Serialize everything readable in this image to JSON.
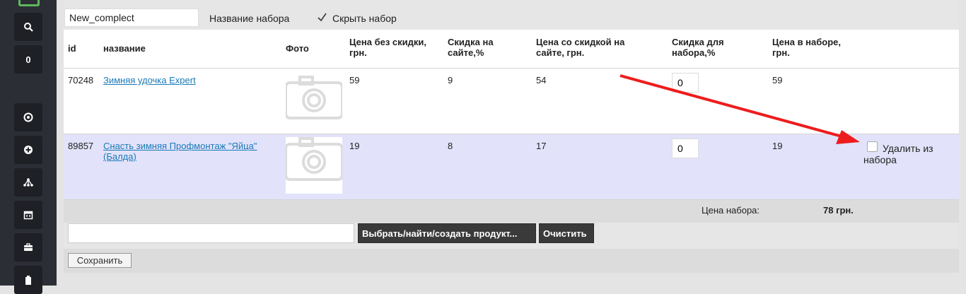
{
  "sidebar": {
    "items": [
      {
        "icon": "search-icon"
      },
      {
        "label": "0"
      },
      {
        "icon": "lifebuoy-icon"
      },
      {
        "icon": "plus-circle-icon"
      },
      {
        "icon": "sitemap-icon"
      },
      {
        "icon": "calendar-icon"
      },
      {
        "icon": "briefcase-icon"
      },
      {
        "icon": "clipboard-icon"
      }
    ]
  },
  "set": {
    "name_value": "New_complect",
    "name_label": "Название набора",
    "hide_checked": true,
    "hide_label": "Скрыть набор"
  },
  "table": {
    "headers": {
      "id": "id",
      "name": "название",
      "photo": "Фото",
      "price": "Цена без скидки, грн.",
      "site_discount": "Скидка на сайте,%",
      "discounted_price": "Цена со скидкой на сайте, грн.",
      "set_discount": "Скидка для набора,%",
      "set_price": "Цена в наборе, грн."
    },
    "rows": [
      {
        "id": "70248",
        "name": "Зимняя удочка Expert",
        "price": "59",
        "site_discount": "9",
        "discounted_price": "54",
        "set_discount": "0",
        "set_price": "59"
      },
      {
        "id": "89857",
        "name": "Снасть зимняя Профмонтаж \"Яйца\" (Балда)",
        "price": "19",
        "site_discount": "8",
        "discounted_price": "17",
        "set_discount": "0",
        "set_price": "19",
        "remove_label": "Удалить из набора"
      }
    ],
    "total_label": "Цена набора:",
    "total_value": "78 грн."
  },
  "product_bar": {
    "input_value": "",
    "select_button": "Выбрать/найти/создать продукт...",
    "clear_button": "Очистить"
  },
  "save_button": "Сохранить",
  "colors": {
    "sidebar": "#2b2e35",
    "link": "#1a7ab8",
    "row_highlight": "#e2e2fa",
    "arrow": "#ee1c1c",
    "dark_button": "#3a3a3a"
  }
}
